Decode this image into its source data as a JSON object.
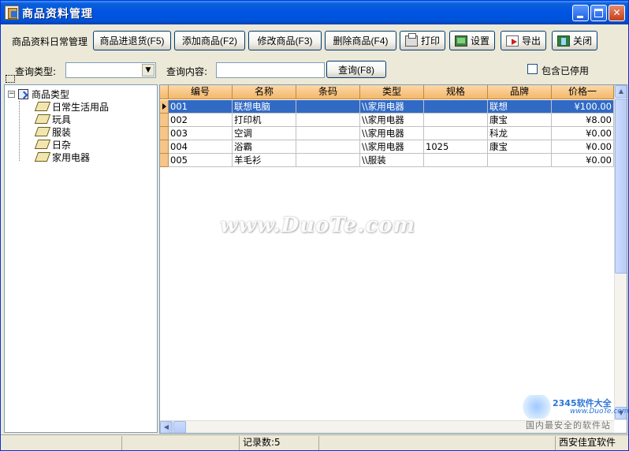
{
  "window": {
    "title": "商品资料管理",
    "controls": {
      "minimize": "_",
      "maximize": "□",
      "close": "✕"
    }
  },
  "toolbar": {
    "label": "商品资料日常管理",
    "buttons": [
      {
        "label": "商品进退货(F5)"
      },
      {
        "label": "添加商品(F2)"
      },
      {
        "label": "修改商品(F3)"
      },
      {
        "label": "删除商品(F4)"
      },
      {
        "label": "打印",
        "icon": "printer-icon"
      },
      {
        "label": "设置",
        "icon": "monitor-settings-icon"
      },
      {
        "label": "导出",
        "icon": "export-icon"
      },
      {
        "label": "关闭",
        "icon": "exit-icon"
      }
    ]
  },
  "query": {
    "type_label": "查询类型:",
    "type_value": "",
    "type_arrow": "▼",
    "content_label": "查询内容:",
    "content_value": "",
    "search_button": "查询(F8)",
    "include_disabled_label": "包含已停用",
    "include_disabled_checked": false
  },
  "tree": {
    "expander": "−",
    "root": "商品类型",
    "children": [
      "日常生活用品",
      "玩具",
      "服装",
      "日杂",
      "家用电器"
    ]
  },
  "grid": {
    "columns": [
      "编号",
      "名称",
      "条码",
      "类型",
      "规格",
      "品牌",
      "价格一"
    ],
    "selected_row": 0,
    "rows": [
      [
        "001",
        "联想电脑",
        "",
        "\\\\家用电器",
        "",
        "联想",
        "¥100.00"
      ],
      [
        "002",
        "打印机",
        "",
        "\\\\家用电器",
        "",
        "康宝",
        "¥8.00"
      ],
      [
        "003",
        "空调",
        "",
        "\\\\家用电器",
        "",
        "科龙",
        "¥0.00"
      ],
      [
        "004",
        "浴霸",
        "",
        "\\\\家用电器",
        "1025",
        "康宝",
        "¥0.00"
      ],
      [
        "005",
        "羊毛衫",
        "",
        "\\\\服装",
        "",
        "",
        "¥0.00"
      ]
    ],
    "scroll_up": "▲",
    "scroll_down": "▼",
    "scroll_left": "◀"
  },
  "status": {
    "record_count": "记录数:5",
    "company": "西安佳宜软件"
  },
  "watermark": "www.DuoTe.com",
  "corner_logo": {
    "text": "2345软件大全",
    "sub": "www.DuoTe.com",
    "tag": "国内最安全的软件站"
  }
}
